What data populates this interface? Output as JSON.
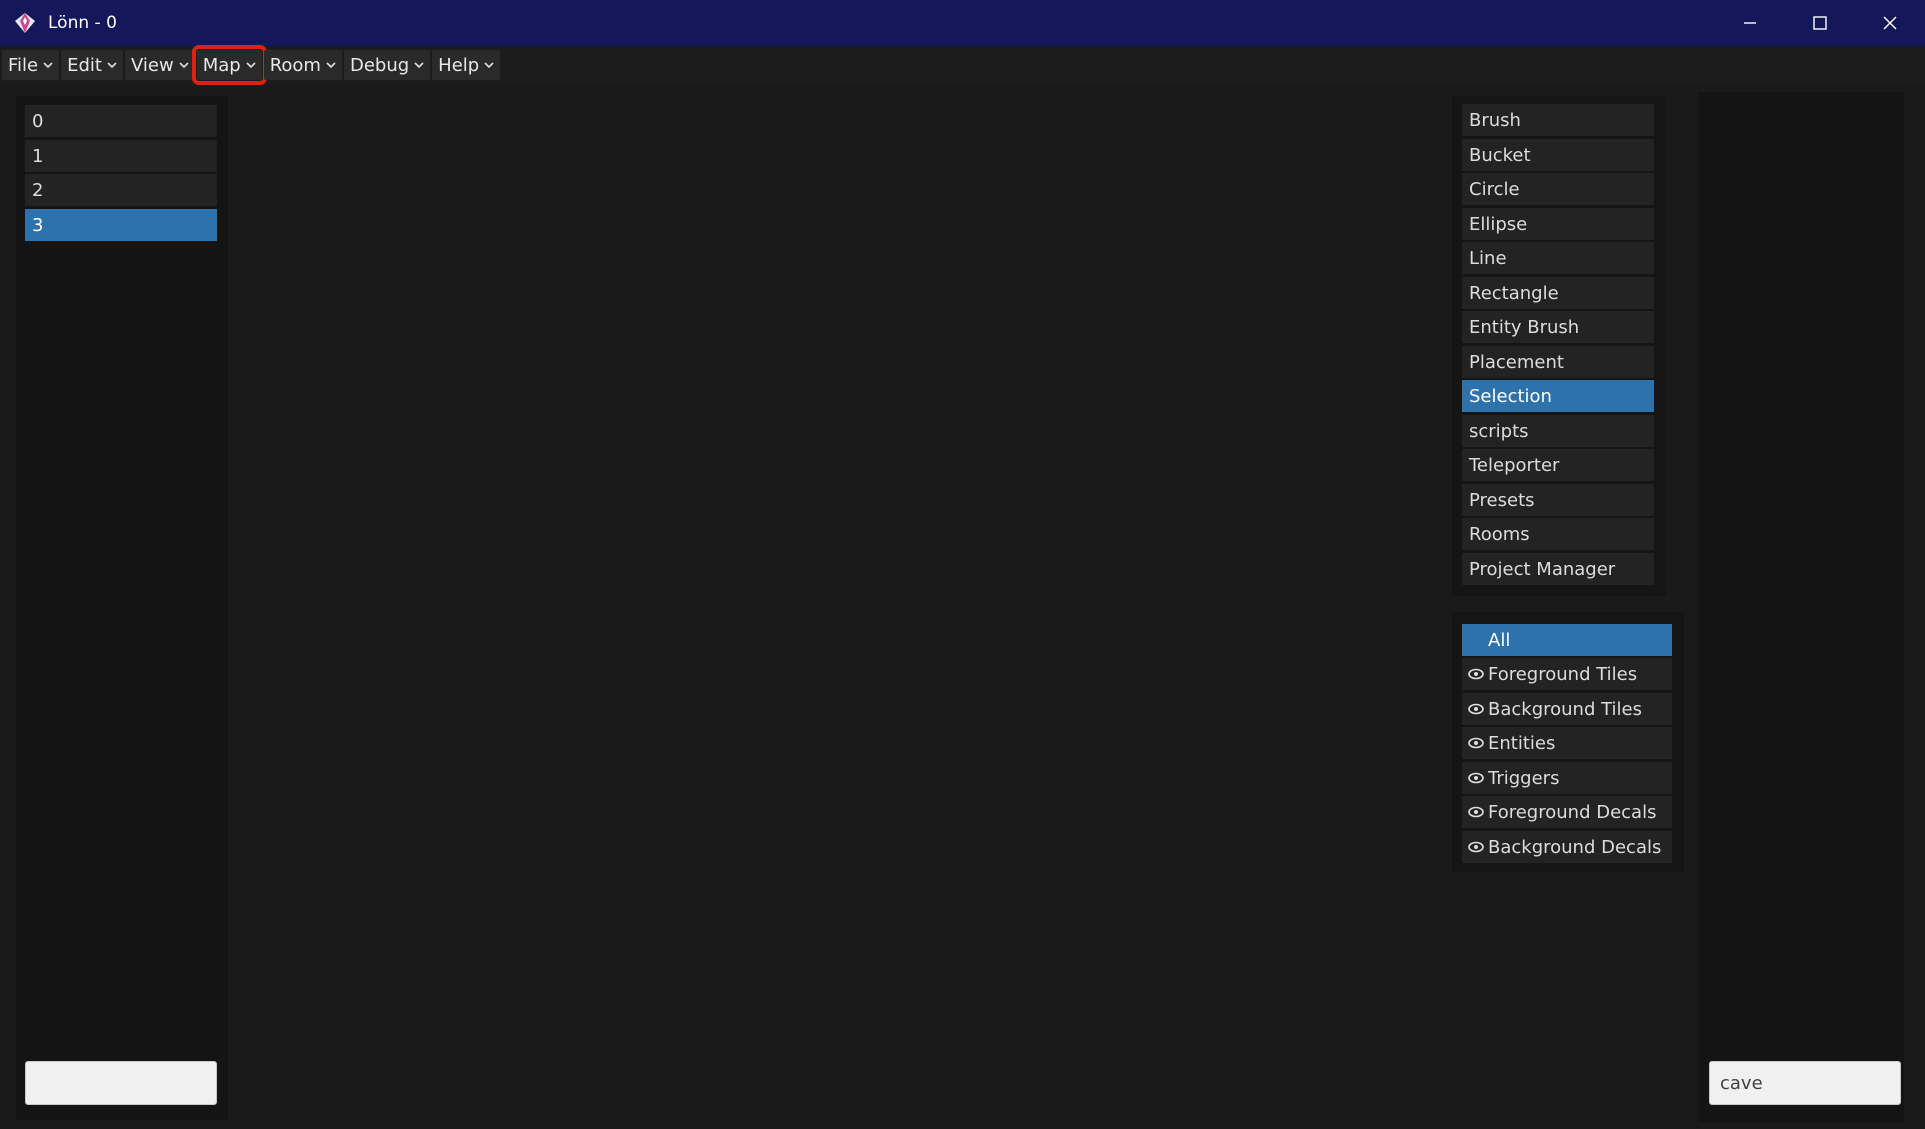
{
  "window": {
    "title": "Lönn - 0"
  },
  "menubar": {
    "items": [
      {
        "label": "File"
      },
      {
        "label": "Edit"
      },
      {
        "label": "View"
      },
      {
        "label": "Map"
      },
      {
        "label": "Room"
      },
      {
        "label": "Debug"
      },
      {
        "label": "Help"
      }
    ],
    "highlighted": "Map"
  },
  "rooms": {
    "items": [
      "0",
      "1",
      "2",
      "3"
    ],
    "selected": "3"
  },
  "tools": {
    "items": [
      "Brush",
      "Bucket",
      "Circle",
      "Ellipse",
      "Line",
      "Rectangle",
      "Entity Brush",
      "Placement",
      "Selection",
      "scripts",
      "Teleporter",
      "Presets",
      "Rooms",
      "Project Manager"
    ],
    "selected": "Selection"
  },
  "layers": {
    "items": [
      "All",
      "Foreground Tiles",
      "Background Tiles",
      "Entities",
      "Triggers",
      "Foreground Decals",
      "Background Decals"
    ],
    "selected": "All"
  },
  "left_search": {
    "value": ""
  },
  "material_search": {
    "value": "cave"
  },
  "colors": {
    "accent": "#2d72aa",
    "titlebar": "#14185a",
    "highlight_box": "#e02010"
  }
}
